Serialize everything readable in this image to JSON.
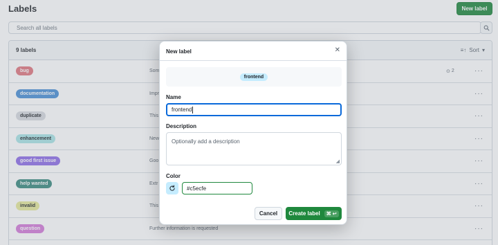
{
  "page": {
    "title": "Labels",
    "new_label_button": "New label",
    "search_placeholder": "Search all labels",
    "label_count": "9 labels",
    "sort_label": "Sort"
  },
  "labels": [
    {
      "name": "bug",
      "color": "#e1777f",
      "text_color": "#ffffff",
      "description": "Som",
      "issues": "2"
    },
    {
      "name": "documentation",
      "color": "#4a8fd6",
      "text_color": "#ffffff",
      "description": "Impr",
      "issues": ""
    },
    {
      "name": "duplicate",
      "color": "#d7dadf",
      "text_color": "#1f2328",
      "description": "This",
      "issues": ""
    },
    {
      "name": "enhancement",
      "color": "#a9e5e6",
      "text_color": "#1f2328",
      "description": "New",
      "issues": ""
    },
    {
      "name": "good first issue",
      "color": "#8e6de8",
      "text_color": "#ffffff",
      "description": "Goo",
      "issues": ""
    },
    {
      "name": "help wanted",
      "color": "#3a8a7e",
      "text_color": "#ffffff",
      "description": "Extr",
      "issues": ""
    },
    {
      "name": "invalid",
      "color": "#e7e99a",
      "text_color": "#1f2328",
      "description": "This",
      "issues": ""
    },
    {
      "name": "question",
      "color": "#d47ad8",
      "text_color": "#ffffff",
      "description": "Further information is requested",
      "issues": ""
    }
  ],
  "dialog": {
    "title": "New label",
    "close_icon": "close-icon",
    "preview_label": "frontend",
    "preview_color": "#c5ecfe",
    "name_label": "Name",
    "name_value": "frontend",
    "description_label": "Description",
    "description_placeholder": "Optionally add a description",
    "color_label": "Color",
    "color_value": "#c5ecfe",
    "cancel_button": "Cancel",
    "create_button": "Create label",
    "create_shortcut": "⌘ ↩"
  }
}
